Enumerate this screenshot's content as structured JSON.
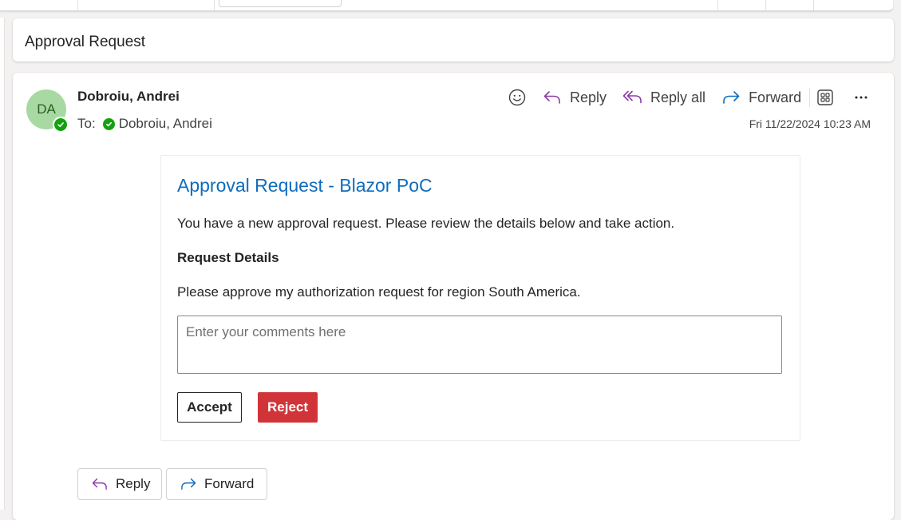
{
  "subject": "Approval Request",
  "message": {
    "avatar_initials": "DA",
    "sender_name": "Dobroiu, Andrei",
    "to_label": "To:",
    "recipient": "Dobroiu, Andrei",
    "timestamp": "Fri 11/22/2024 10:23 AM",
    "actions": {
      "reply": "Reply",
      "reply_all": "Reply all",
      "forward": "Forward"
    }
  },
  "card": {
    "title": "Approval Request - Blazor PoC",
    "intro": "You have a new approval request. Please review the details below and take action.",
    "details_label": "Request Details",
    "details_body": "Please approve my authorization request for region South America.",
    "comments_placeholder": "Enter your comments here",
    "accept_label": "Accept",
    "reject_label": "Reject"
  },
  "footer": {
    "reply": "Reply",
    "forward": "Forward"
  },
  "colors": {
    "accent": "#0f6cbd",
    "reject": "#d13438",
    "presence": "#13a10e",
    "avatar_bg": "#a9d9a3",
    "reply_icon": "#8e3ba8"
  },
  "icons": [
    "emoji-icon",
    "reply-icon",
    "reply-all-icon",
    "forward-icon",
    "apps-icon",
    "more-icon",
    "check-icon"
  ]
}
